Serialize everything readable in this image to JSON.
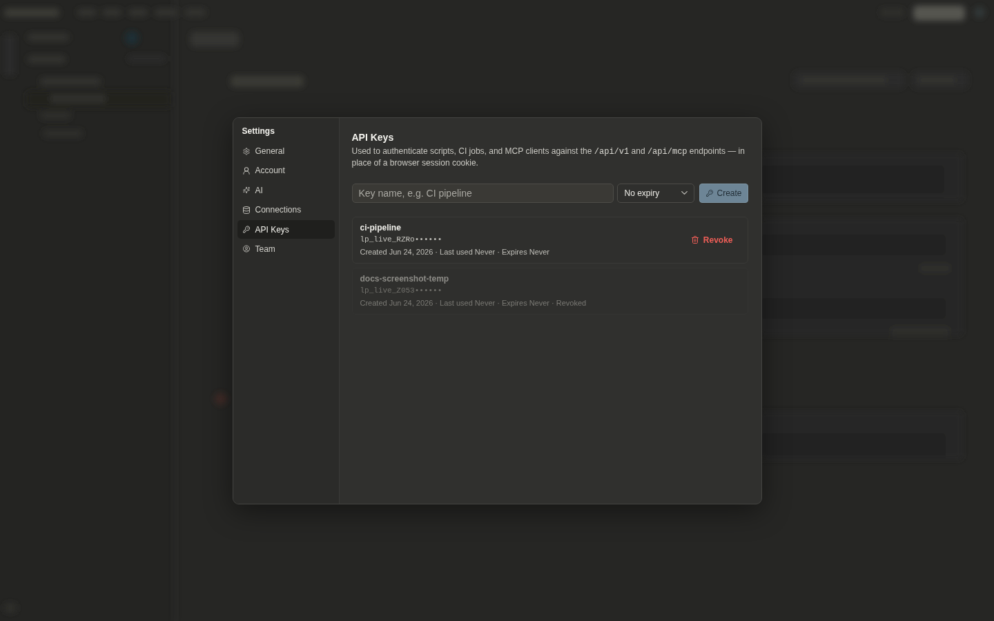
{
  "settings_dialog": {
    "sidebar": {
      "title": "Settings",
      "items": [
        {
          "label": "General",
          "selected": false
        },
        {
          "label": "Account",
          "selected": false
        },
        {
          "label": "AI",
          "selected": false
        },
        {
          "label": "Connections",
          "selected": false
        },
        {
          "label": "API Keys",
          "selected": true
        },
        {
          "label": "Team",
          "selected": false
        }
      ]
    },
    "section": {
      "title": "API Keys",
      "description": [
        {
          "kind": "text",
          "text": "Used to authenticate scripts, CI jobs, and MCP clients against the "
        },
        {
          "kind": "code",
          "text": "/api/v1"
        },
        {
          "kind": "text",
          "text": " and "
        },
        {
          "kind": "code",
          "text": "/api/mcp"
        },
        {
          "kind": "text",
          "text": " endpoints — in place of a browser session cookie."
        }
      ]
    },
    "create_form": {
      "name_field": {
        "placeholder": "Key name, e.g. CI pipeline"
      },
      "expiry_select": {
        "value": "No expiry"
      },
      "create_button": {
        "label": "Create"
      }
    },
    "keys": [
      {
        "name": "ci-pipeline",
        "key": "lp_live_RZRo••••••",
        "details": "Created Jun 24, 2026 · Last used Never · Expires Never",
        "revoked": false,
        "action": "Revoke"
      },
      {
        "name": "docs-screenshot-temp",
        "key": "lp_live_Z053••••••",
        "details": "Created Jun 24, 2026 · Last used Never · Expires Never · Revoked",
        "revoked": true
      }
    ]
  }
}
